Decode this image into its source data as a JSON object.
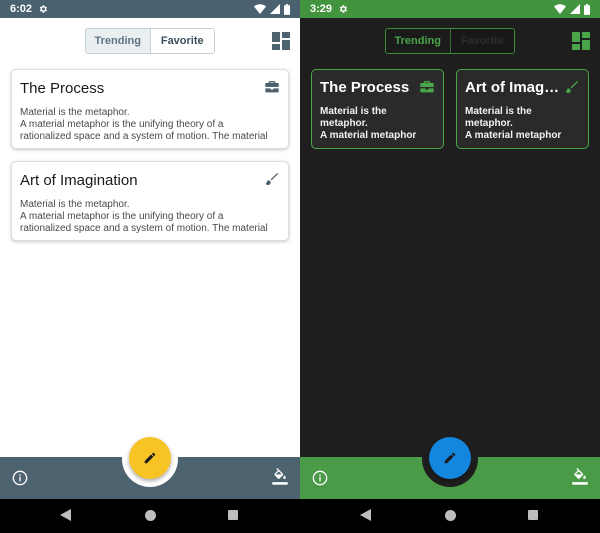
{
  "light": {
    "status": {
      "time": "6:02"
    },
    "toggle": {
      "trending": "Trending",
      "favorite": "Favorite"
    },
    "cards": [
      {
        "title": "The Process",
        "icon": "briefcase-icon",
        "line1": "Material is the metaphor.",
        "line2": " A material metaphor is the unifying theory of a",
        "line3": "rationalized space and a system of motion. The material"
      },
      {
        "title": "Art of Imagination",
        "icon": "brush-icon",
        "line1": "Material is the metaphor.",
        "line2": " A material metaphor is the unifying theory of a",
        "line3": "rationalized space and a system of motion. The material"
      }
    ],
    "colors": {
      "bar": "#4e6370",
      "fab": "#f7c325",
      "icon": "#4e6370"
    }
  },
  "dark": {
    "status": {
      "time": "3:29"
    },
    "toggle": {
      "trending": "Trending",
      "favorite": "Favorite"
    },
    "cards": [
      {
        "title": "The Process",
        "icon": "briefcase-icon",
        "line1": "Material is the",
        "line2": "metaphor.",
        "line3": " A material metaphor"
      },
      {
        "title": "Art of Imagination",
        "icon": "brush-icon",
        "line1": "Material is the",
        "line2": "metaphor.",
        "line3": " A material metaphor"
      }
    ],
    "colors": {
      "bar": "#4a9b47",
      "fab": "#1386de",
      "icon": "#4aa449"
    }
  }
}
